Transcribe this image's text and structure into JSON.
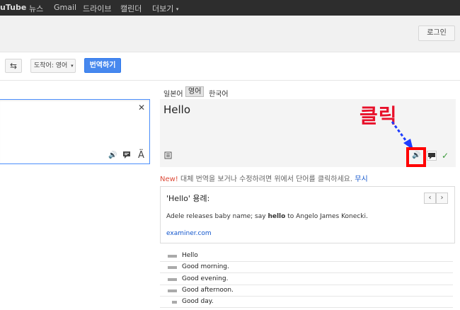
{
  "topbar": {
    "items": [
      "uTube",
      "뉴스",
      "Gmail",
      "드라이브",
      "캘린더",
      "더보기"
    ],
    "more_caret": "▾"
  },
  "header": {
    "login_label": "로그인"
  },
  "toolbar": {
    "swap_icon": "⇆",
    "target_lang_select": "도착어: 영어",
    "select_caret": "▾",
    "translate_label": "번역하기"
  },
  "source": {
    "clear_icon": "✕",
    "speaker_icon": "🔊",
    "keyboard_icon": "▪",
    "font_icon": "Ä"
  },
  "target": {
    "lang_tabs": [
      "일본어",
      "영어",
      "한국어"
    ],
    "result_text": "Hello",
    "list_icon": "≣",
    "speaker_icon": "🔊",
    "feedback_icon": "▪",
    "check_icon": "✓"
  },
  "annotation": {
    "text": "클릭",
    "color": "#e8102a"
  },
  "hint": {
    "new_label": "New!",
    "text": " 대체 번역을 보거나 수정하려면 위에서 단어를 클릭하세요. ",
    "ignore_label": "무시"
  },
  "examples": {
    "title": "'Hello' 용례:",
    "sentence_before": "Adele releases baby name; say ",
    "sentence_bold": "hello",
    "sentence_after": " to Angelo James Konecki.",
    "source": "examiner.com",
    "prev_icon": "‹",
    "next_icon": "›"
  },
  "alternatives": [
    {
      "text": "Hello",
      "frequency": 1.0
    },
    {
      "text": "Good morning.",
      "frequency": 1.0
    },
    {
      "text": "Good evening.",
      "frequency": 1.0
    },
    {
      "text": "Good afternoon.",
      "frequency": 1.0
    },
    {
      "text": "Good day.",
      "frequency": 0.5
    }
  ]
}
